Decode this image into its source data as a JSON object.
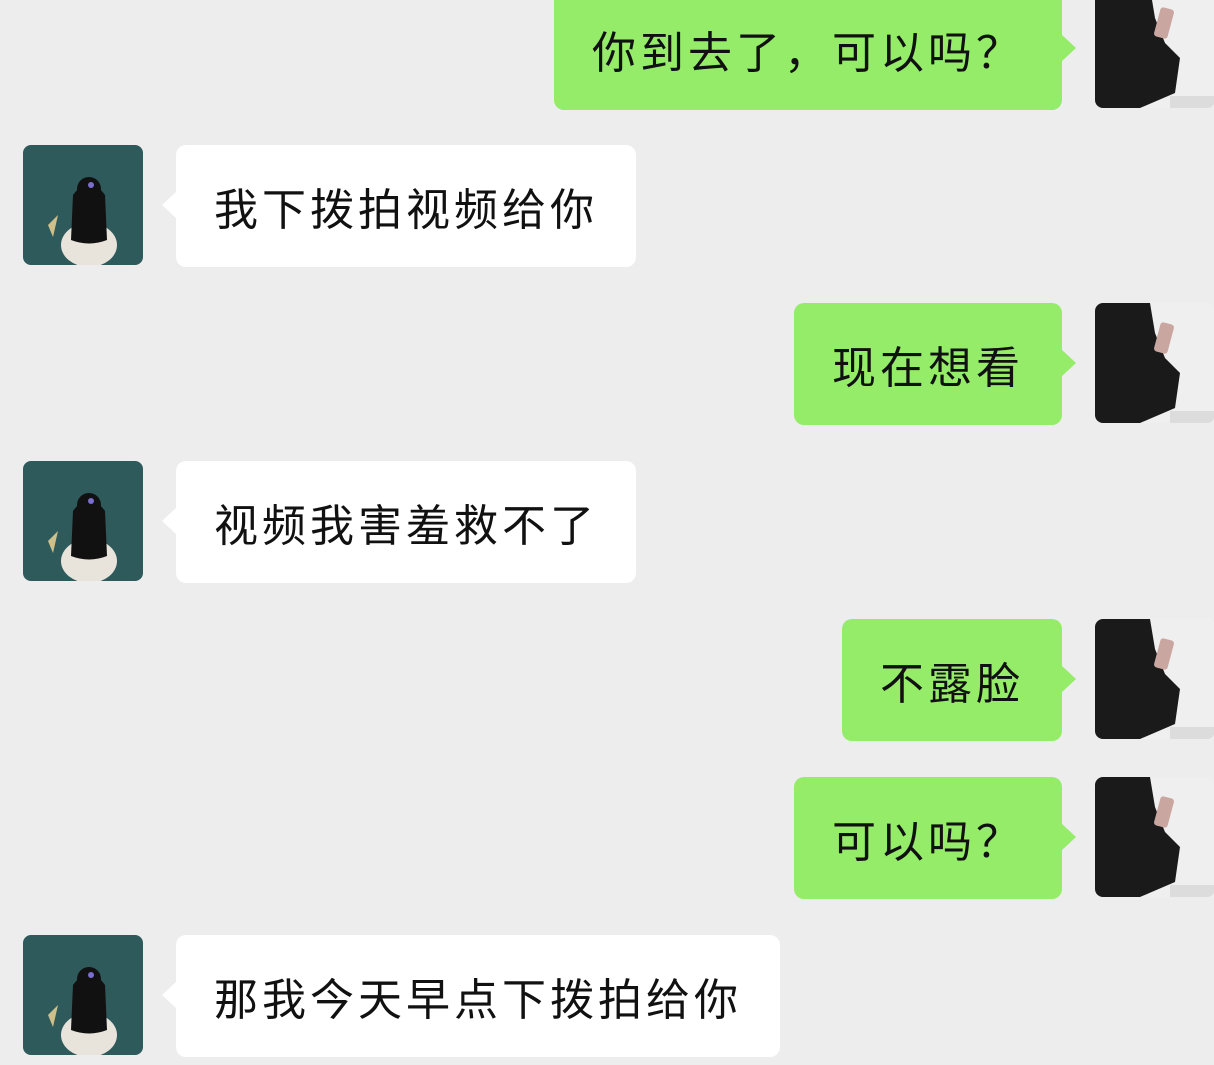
{
  "colors": {
    "background": "#ededed",
    "self_bubble": "#95ec69",
    "peer_bubble": "#ffffff",
    "peer_avatar_bg": "#2f5a5c"
  },
  "messages": [
    {
      "sender": "self",
      "text": "你到去了，可以吗？"
    },
    {
      "sender": "peer",
      "text": "我下拨拍视频给你"
    },
    {
      "sender": "self",
      "text": "现在想看"
    },
    {
      "sender": "peer",
      "text": "视频我害羞救不了"
    },
    {
      "sender": "self",
      "text": "不露脸"
    },
    {
      "sender": "self",
      "text": "可以吗？"
    },
    {
      "sender": "peer",
      "text": "那我今天早点下拨拍给你"
    }
  ]
}
